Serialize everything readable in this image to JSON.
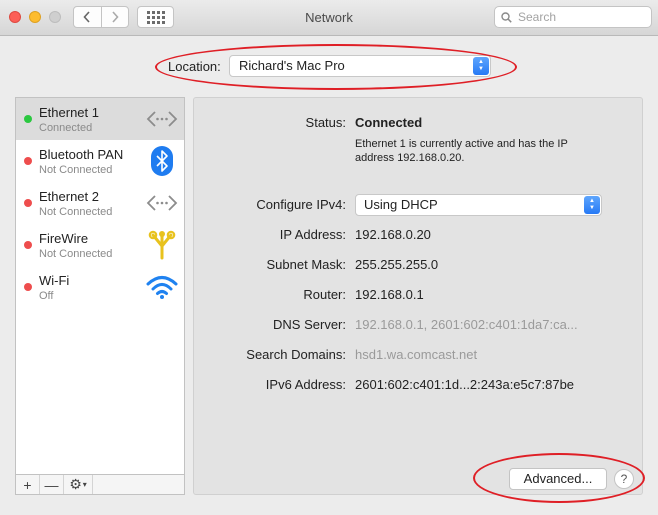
{
  "window": {
    "title": "Network"
  },
  "toolbar": {
    "back_icon": "chevron-left-icon",
    "forward_icon": "chevron-right-icon",
    "show_all_icon": "grid-icon"
  },
  "search": {
    "placeholder": "Search"
  },
  "location": {
    "label": "Location:",
    "value": "Richard's Mac Pro"
  },
  "services": [
    {
      "name": "Ethernet 1",
      "status": "Connected",
      "status_color": "#2bc840",
      "icon": "ethernet-icon",
      "selected": true
    },
    {
      "name": "Bluetooth PAN",
      "status": "Not Connected",
      "status_color": "#ee4d4d",
      "icon": "bluetooth-icon",
      "selected": false
    },
    {
      "name": "Ethernet 2",
      "status": "Not Connected",
      "status_color": "#ee4d4d",
      "icon": "ethernet-icon",
      "selected": false
    },
    {
      "name": "FireWire",
      "status": "Not Connected",
      "status_color": "#ee4d4d",
      "icon": "firewire-icon",
      "selected": false
    },
    {
      "name": "Wi-Fi",
      "status": "Off",
      "status_color": "#ee4d4d",
      "icon": "wifi-icon",
      "selected": false
    }
  ],
  "sidebar_controls": {
    "add": "+",
    "remove": "—",
    "gear_icon": "gear-icon"
  },
  "detail": {
    "status_label": "Status:",
    "status_value": "Connected",
    "status_description": "Ethernet 1 is currently active and has the IP address 192.168.0.20.",
    "configure_label": "Configure IPv4:",
    "configure_value": "Using DHCP",
    "ip_label": "IP Address:",
    "ip_value": "192.168.0.20",
    "subnet_label": "Subnet Mask:",
    "subnet_value": "255.255.255.0",
    "router_label": "Router:",
    "router_value": "192.168.0.1",
    "dns_label": "DNS Server:",
    "dns_value": "192.168.0.1, 2601:602:c401:1da7:ca...",
    "search_domains_label": "Search Domains:",
    "search_domains_value": "hsd1.wa.comcast.net",
    "ipv6_label": "IPv6 Address:",
    "ipv6_value": "2601:602:c401:1d...2:243a:e5c7:87be",
    "advanced_label": "Advanced...",
    "help_label": "?"
  },
  "annotation_color": "#df1f26"
}
